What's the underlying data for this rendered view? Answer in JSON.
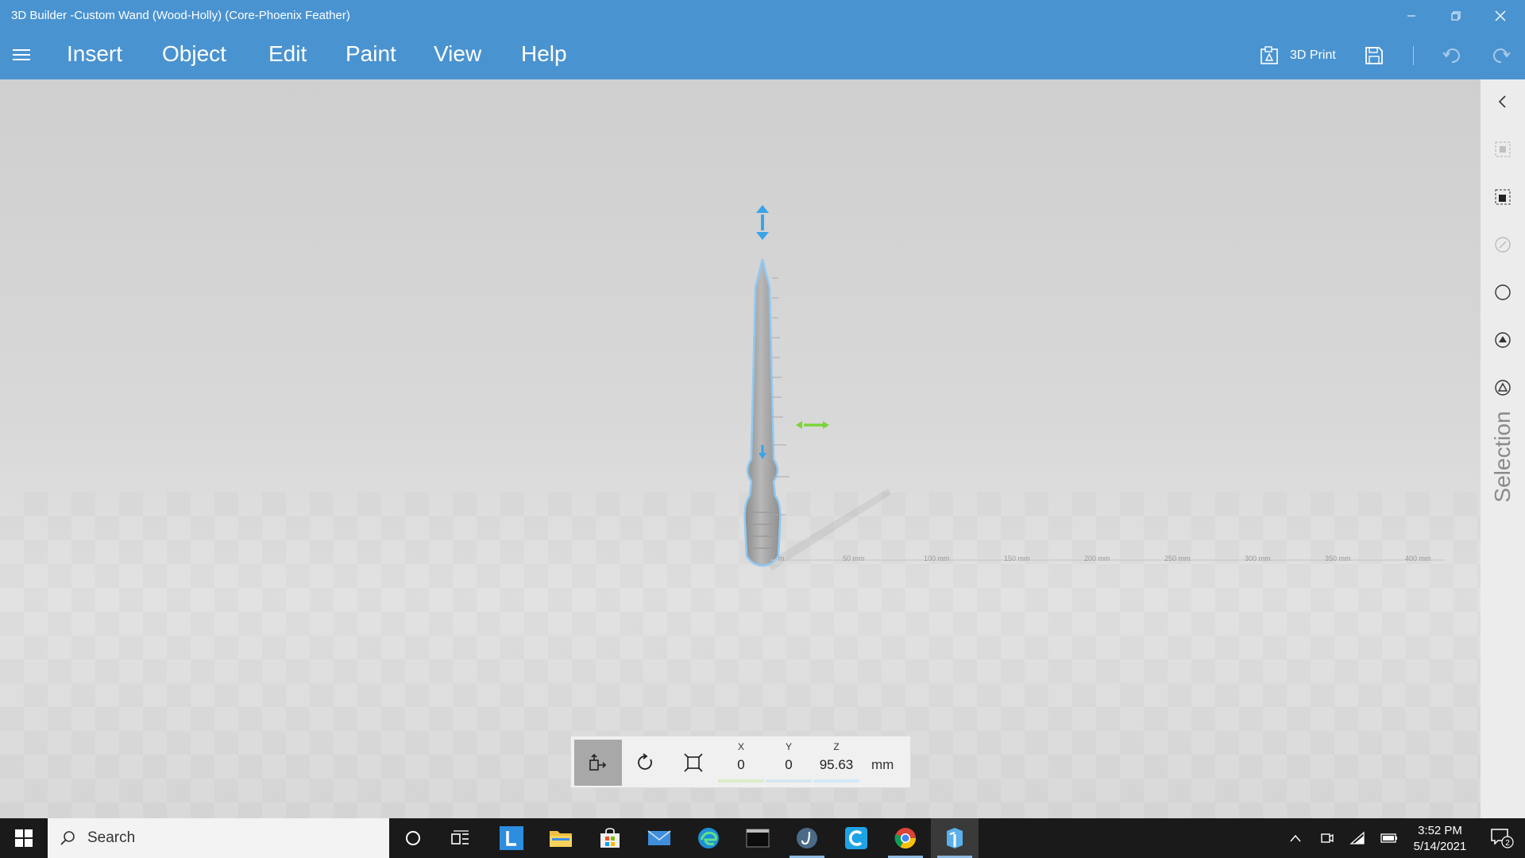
{
  "window": {
    "title": "3D Builder -Custom Wand (Wood-Holly) (Core-Phoenix Feather)"
  },
  "menu": {
    "items": [
      "Insert",
      "Object",
      "Edit",
      "Paint",
      "View",
      "Help"
    ],
    "print_label": "3D Print"
  },
  "sidebar": {
    "label": "Selection",
    "icons": [
      "collapse-chevron-icon",
      "select-object-icon",
      "select-face-icon",
      "edit-icon",
      "circle-select-icon",
      "paint-icon",
      "triangle-select-icon"
    ]
  },
  "ruler": {
    "ticks": [
      "m",
      "50 mm",
      "100 mm",
      "150 mm",
      "200 mm",
      "250 mm",
      "300 mm",
      "350 mm",
      "400 mm"
    ]
  },
  "coordinates": {
    "x_label": "X",
    "x_value": "0",
    "y_label": "Y",
    "y_value": "0",
    "z_label": "Z",
    "z_value": "95.63",
    "unit": "mm"
  },
  "taskbar": {
    "search_placeholder": "Search",
    "time": "3:52 PM",
    "date": "5/14/2021",
    "notification_count": "2"
  },
  "colors": {
    "accent": "#4a93d1",
    "selection": "#3aa3e8",
    "move_arrow_green": "#7cd43a",
    "taskbar": "#1a1a1a"
  }
}
